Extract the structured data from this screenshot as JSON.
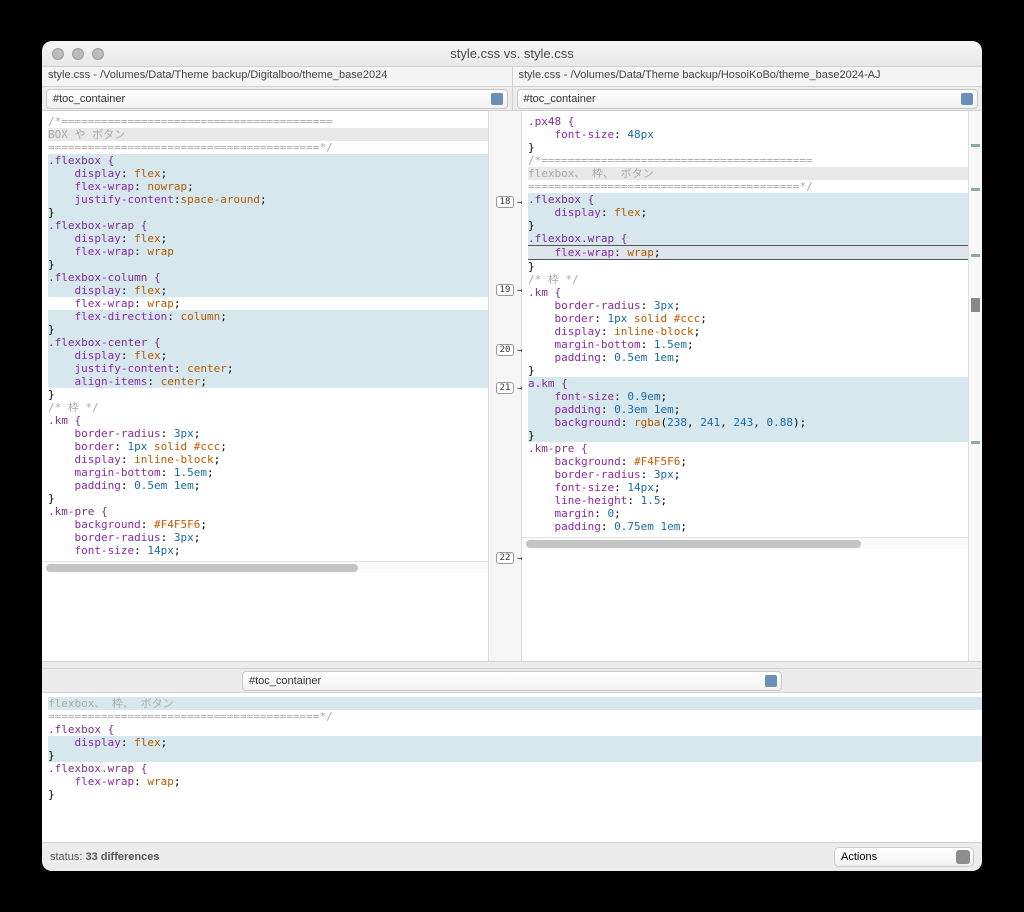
{
  "window": {
    "title": "style.css vs. style.css"
  },
  "paths": {
    "left": "style.css - /Volumes/Data/Theme backup/Digitalboo/theme_base2024",
    "right": "style.css - /Volumes/Data/Theme backup/HosoiKoBo/theme_base2024-AJ"
  },
  "dropdown": {
    "left": "#toc_container",
    "right": "#toc_container",
    "merge": "#toc_container"
  },
  "connectors": [
    "18",
    "19",
    "20",
    "21",
    "22"
  ],
  "left_code": {
    "blank1": "",
    "cmt_open": "/*=========================================",
    "cmt_box": "BOX や ボタン",
    "cmt_close": "=========================================*/",
    "flexbox": ".flexbox {",
    "fb_disp": "    display: flex;",
    "fb_wrap": "    flex-wrap: nowrap;",
    "fb_jc": "    justify-content:space-around;",
    "brace": "}",
    "fbwrap": ".flexbox-wrap {",
    "fbw_disp": "    display: flex;",
    "fbw_wrap": "    flex-wrap: wrap",
    "fbcol": ".flexbox-column {",
    "fbc_disp": "    display: flex;",
    "fbc_wrap": "    flex-wrap: wrap;",
    "fbc_dir": "    flex-direction: column;",
    "fbcen": ".flexbox-center {",
    "fbcn_disp": "    display: flex;",
    "fbcn_jc": "    justify-content: center;",
    "fbcn_ai": "    align-items: center;",
    "km_cmt": "/* 枠 */",
    "km": ".km {",
    "km_br": "    border-radius: 3px;",
    "km_bd": "    border: 1px solid #ccc;",
    "km_dp": "    display: inline-block;",
    "km_mb": "    margin-bottom: 1.5em;",
    "km_pd": "    padding: 0.5em 1em;",
    "kmpre": ".km-pre {",
    "kmp_bg": "    background: #F4F5F6;",
    "kmp_br": "    border-radius: 3px;",
    "kmp_fs": "    font-size: 14px;"
  },
  "right_code": {
    "px48": ".px48 {",
    "px48_fs": "    font-size: 48px",
    "brace": "}",
    "cmt_open": "/*=========================================",
    "cmt_box": "flexbox、 枠、 ボタン",
    "cmt_close": "=========================================*/",
    "flexbox": ".flexbox {",
    "fb_disp": "    display: flex;",
    "fbwrap": ".flexbox.wrap {",
    "fbw_wrap": "    flex-wrap: wrap;",
    "km_cmt": "/* 枠 */",
    "km": ".km {",
    "km_br": "    border-radius: 3px;",
    "km_bd": "    border: 1px solid #ccc;",
    "km_dp": "    display: inline-block;",
    "km_mb": "    margin-bottom: 1.5em;",
    "km_pd": "    padding: 0.5em 1em;",
    "akm": "a.km {",
    "akm_fs": "    font-size: 0.9em;",
    "akm_pd": "    padding: 0.3em 1em;",
    "akm_bg": "    background: rgba(238, 241, 243, 0.88);",
    "kmpre": ".km-pre {",
    "kmp_bg": "    background: #F4F5F6;",
    "kmp_br": "    border-radius: 3px;",
    "kmp_fs": "    font-size: 14px;",
    "kmp_lh": "    line-height: 1.5;",
    "kmp_mg": "    margin: 0;",
    "kmp_pd": "    padding: 0.75em 1em;"
  },
  "merge_code": {
    "cmt_box": "flexbox、 枠、 ボタン",
    "cmt_close": "=========================================*/",
    "flexbox": ".flexbox {",
    "fb_disp": "    display: flex;",
    "brace": "}",
    "fbwrap": ".flexbox.wrap {",
    "fbw_wrap": "    flex-wrap: wrap;"
  },
  "status": {
    "label": "status:",
    "count": "33 differences"
  },
  "actions": {
    "label": "Actions"
  }
}
